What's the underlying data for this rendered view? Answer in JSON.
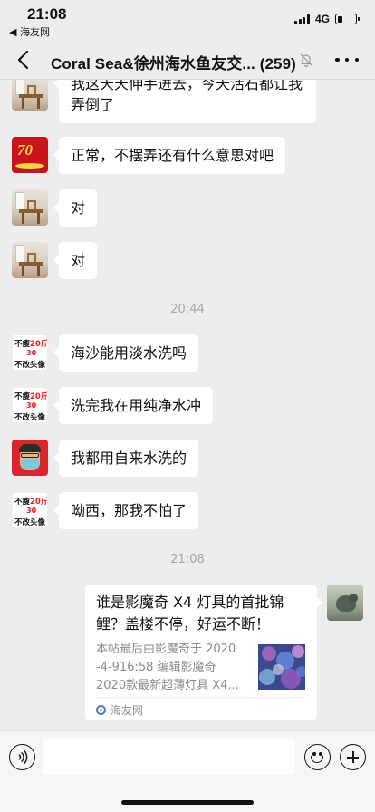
{
  "status_bar": {
    "time": "21:08",
    "back_app": "◀ 海友网",
    "network": "4G",
    "battery_level": 0.3
  },
  "nav": {
    "title": "Coral Sea&徐州海水鱼友交... (259)",
    "icons": [
      "back-chevron-icon",
      "mute-bell-icon",
      "more-dots-icon"
    ]
  },
  "messages": [
    {
      "side": "left",
      "avatar": "room-photo",
      "text": "我这天天伸手进去，今天活石都让我弄倒了"
    },
    {
      "side": "left",
      "avatar": "red-70-badge",
      "text": "正常，不摆弄还有什么意思对吧"
    },
    {
      "side": "left",
      "avatar": "room-photo",
      "text": "对"
    },
    {
      "side": "left",
      "avatar": "room-photo",
      "text": "对"
    },
    {
      "time": "20:44"
    },
    {
      "side": "left",
      "avatar": "text-avatar",
      "text": "海沙能用淡水洗吗"
    },
    {
      "side": "left",
      "avatar": "text-avatar",
      "text": "洗完我在用纯净水冲"
    },
    {
      "side": "left",
      "avatar": "mask-cartoon",
      "text": "我都用自来水洗的"
    },
    {
      "side": "left",
      "avatar": "text-avatar",
      "text": "呦西，那我不怕了"
    },
    {
      "time": "21:08"
    },
    {
      "side": "right",
      "avatar": "self-photo",
      "card": {
        "title": "谁是影魔奇 X4 灯具的首批锦鲤？盖楼不停，好运不断！",
        "desc_lines": [
          "本帖最后由影魔奇于 2020",
          "-4-916:58 编辑影魔奇",
          "2020款最新超薄灯具 X4..."
        ],
        "source": "海友网"
      }
    }
  ],
  "text_avatar": {
    "line1": "不瘦",
    "line1_red": "20斤",
    "line2": "30",
    "line3": "不改头像"
  },
  "flag_avatar": {
    "text": "70"
  },
  "input": {
    "placeholder": ""
  },
  "colors": {
    "background": "#ededed",
    "bubble": "#ffffff",
    "accent_red": "#c8151b"
  }
}
